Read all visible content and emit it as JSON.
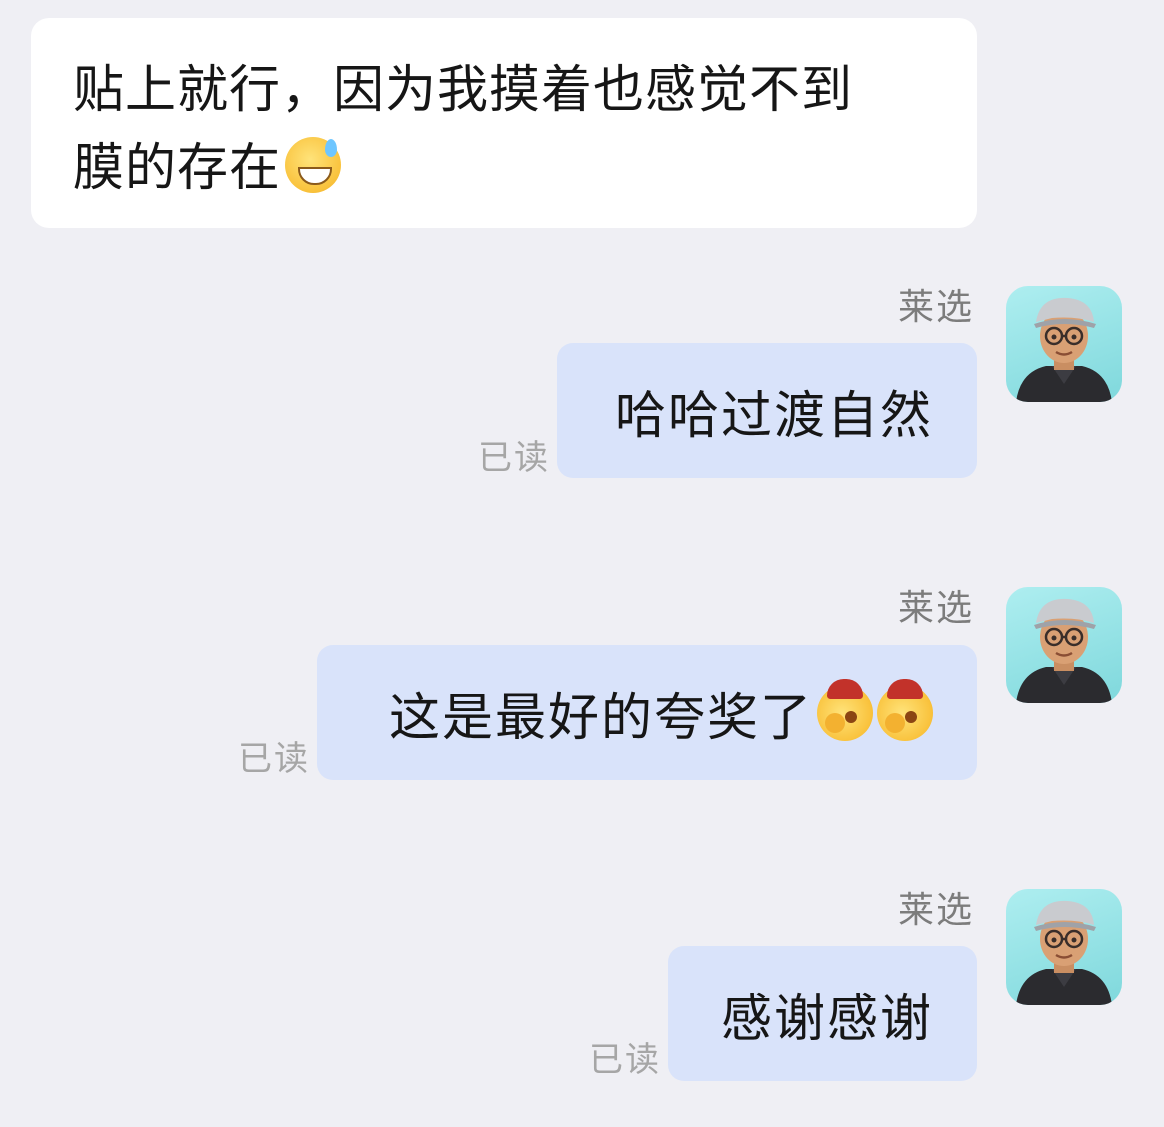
{
  "top_cut_text": "",
  "incoming": {
    "line1": "贴上就行，因为我摸着也感觉不到",
    "line2": "膜的存在",
    "emoji": "grinning-sweat-emoji"
  },
  "messages": [
    {
      "sender": "莱选",
      "text": "哈哈过渡自然",
      "read": "已读"
    },
    {
      "sender": "莱选",
      "text": "这是最好的夸奖了",
      "emojis": [
        "face-hand-over-mouth-emoji",
        "face-hand-over-mouth-emoji"
      ],
      "read": "已读"
    },
    {
      "sender": "莱选",
      "text": "感谢感谢",
      "read": "已读"
    }
  ],
  "colors": {
    "background": "#efeff4",
    "incoming_bubble": "#ffffff",
    "outgoing_bubble": "#d9e3fa",
    "avatar_bg": "#aeeef0"
  }
}
